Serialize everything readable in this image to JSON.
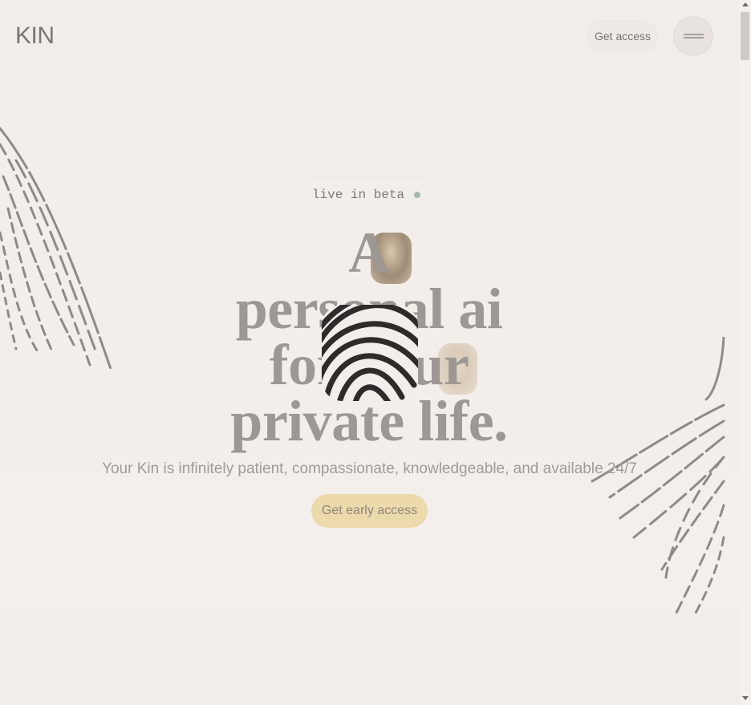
{
  "header": {
    "logo": "KIN",
    "access_label": "Get access",
    "menu_icon": "hamburger-icon"
  },
  "hero": {
    "badge": "live in beta",
    "headline": [
      "A",
      "personal ai",
      "for your",
      "private life."
    ],
    "subtitle": "Your Kin is infinitely patient, compassionate, knowledgeable, and available 24/7",
    "cta_label": "Get early access"
  },
  "colors": {
    "background": "#f1ede9",
    "cta": "#ecd9ac",
    "badge_dot": "#a8b7ac"
  }
}
